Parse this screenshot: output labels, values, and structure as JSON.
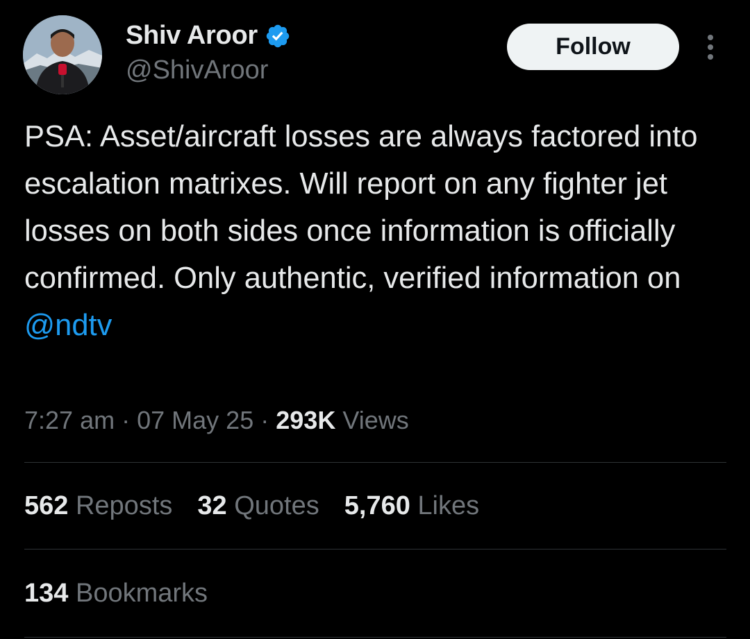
{
  "author": {
    "display_name": "Shiv Aroor",
    "handle": "@ShivAroor",
    "verified_icon": "verified-badge-icon",
    "avatar_icon": "avatar-photo"
  },
  "header": {
    "follow_label": "Follow",
    "more_icon": "more-options-icon"
  },
  "tweet": {
    "text": "PSA: Asset/aircraft losses are always factored into escalation matrixes. Will report on any fighter jet losses on both sides once information is officially confirmed. Only authentic, verified information on ",
    "mention": "@ndtv"
  },
  "meta": {
    "time": "7:27 am",
    "separator": "·",
    "date": "07 May 25",
    "views_count": "293K",
    "views_label": "Views"
  },
  "stats": {
    "reposts_count": "562",
    "reposts_label": "Reposts",
    "quotes_count": "32",
    "quotes_label": "Quotes",
    "likes_count": "5,760",
    "likes_label": "Likes",
    "bookmarks_count": "134",
    "bookmarks_label": "Bookmarks"
  },
  "colors": {
    "background": "#000000",
    "text_primary": "#e7e9ea",
    "text_secondary": "#71767b",
    "accent": "#1d9bf0",
    "divider": "#2f3336"
  }
}
